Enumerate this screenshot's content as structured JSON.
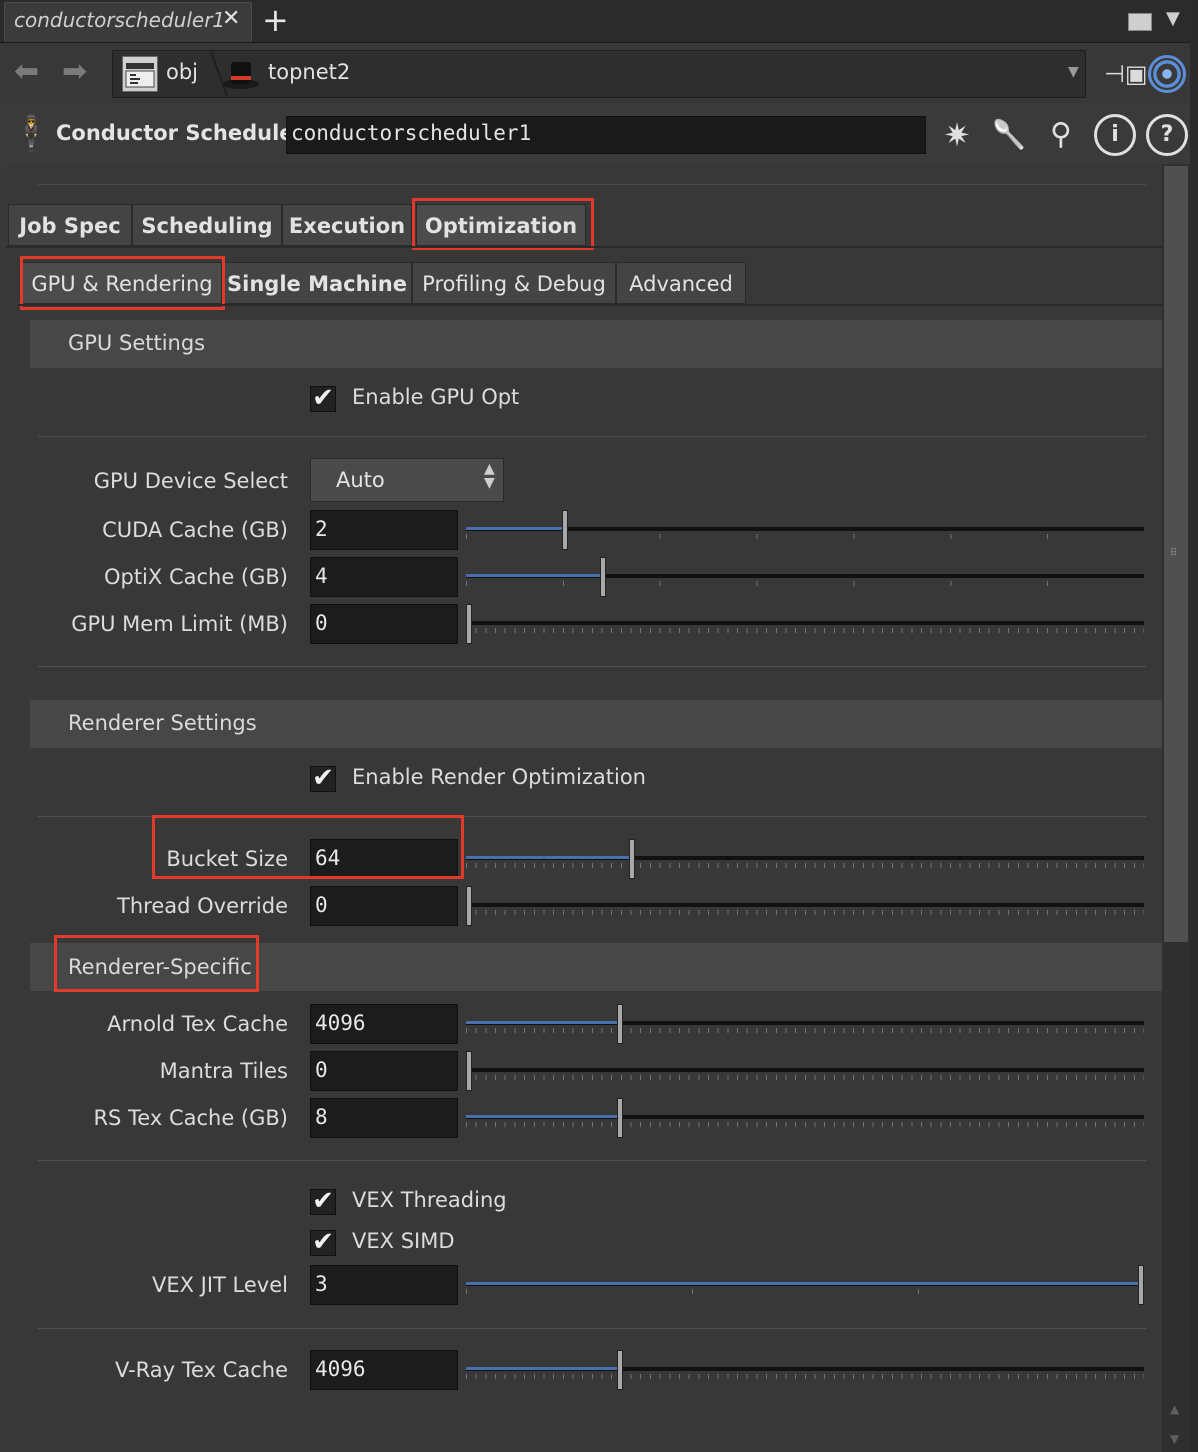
{
  "tab": {
    "title": "conductorscheduler1"
  },
  "path": {
    "items": [
      "obj",
      "topnet2"
    ]
  },
  "operator": {
    "type": "Conductor Scheduler",
    "name": "conductorscheduler1"
  },
  "tabs_primary": [
    "Job Spec",
    "Scheduling",
    "Execution",
    "Optimization"
  ],
  "tabs_secondary": [
    "GPU & Rendering",
    "Single Machine",
    "Profiling & Debug",
    "Advanced"
  ],
  "gpu": {
    "section": "GPU Settings",
    "enable_label": "Enable GPU Opt",
    "device_label": "GPU Device Select",
    "device_value": "Auto",
    "cuda_label": "CUDA Cache (GB)",
    "cuda_value": "2",
    "cuda_level": 0.143,
    "optix_label": "OptiX Cache (GB)",
    "optix_value": "4",
    "optix_level": 0.2,
    "memlimit_label": "GPU Mem Limit (MB)",
    "memlimit_value": "0",
    "memlimit_level": 0
  },
  "renderer": {
    "section": "Renderer Settings",
    "enable_label": "Enable Render Optimization",
    "bucket_label": "Bucket Size",
    "bucket_value": "64",
    "bucket_level": 0.243,
    "thread_label": "Thread Override",
    "thread_value": "0",
    "thread_level": 0
  },
  "specific": {
    "section": "Renderer-Specific",
    "arnold_label": "Arnold Tex Cache",
    "arnold_value": "4096",
    "arnold_level": 0.225,
    "mantra_label": "Mantra Tiles",
    "mantra_value": "0",
    "mantra_level": 0,
    "rs_label": "RS Tex Cache (GB)",
    "rs_value": "8",
    "rs_level": 0.225,
    "vex_threading_label": "VEX Threading",
    "vex_simd_label": "VEX SIMD",
    "vex_jit_label": "VEX JIT Level",
    "vex_jit_value": "3",
    "vex_jit_level": 1.0,
    "vray_label": "V-Ray Tex Cache",
    "vray_value": "4096",
    "vray_level": 0.225
  },
  "checkmark": "✔",
  "colors": {
    "highlight": "#e23a2a",
    "slider_fill": "#4a6fb0",
    "link_ring": "#5b8fd8"
  }
}
